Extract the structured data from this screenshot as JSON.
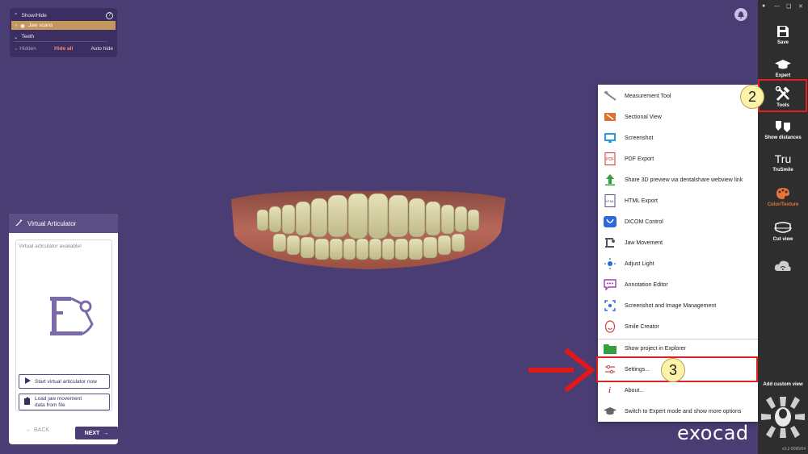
{
  "show_hide": {
    "title": "Show/Hide",
    "help": "?",
    "jaw_scans": "Jaw scans",
    "teeth": "Teeth",
    "hidden": "Hidden",
    "hide_all": "Hide all",
    "auto_hide": "Auto hide"
  },
  "articulator": {
    "title": "Virtual Articulator",
    "available": "Virtual articulator available!",
    "start_button": "Start virtual articulator now",
    "load_line1": "Load jaw movement",
    "load_line2": "data from file",
    "back": "BACK",
    "next": "NEXT"
  },
  "tools_menu": {
    "items": [
      {
        "label": "Measurement Tool",
        "icon": "caliper-icon"
      },
      {
        "label": "Sectional View",
        "icon": "sectional-view-icon"
      },
      {
        "label": "Screenshot",
        "icon": "monitor-icon"
      },
      {
        "label": "PDF Export",
        "icon": "pdf-icon"
      },
      {
        "label": "Share 3D preview via dentalshare webview link",
        "icon": "upload-arrow-icon"
      },
      {
        "label": "HTML Export",
        "icon": "html-icon"
      },
      {
        "label": "DICOM Control",
        "icon": "dicom-icon"
      },
      {
        "label": "Jaw Movement",
        "icon": "jaw-movement-icon"
      },
      {
        "label": "Adjust Light",
        "icon": "light-icon"
      },
      {
        "label": "Annotation Editor",
        "icon": "speech-bubble-icon"
      },
      {
        "label": "Screenshot and Image Management",
        "icon": "capture-icon"
      },
      {
        "label": "Smile Creator",
        "icon": "smile-icon"
      },
      {
        "label": "Show project in Explorer",
        "icon": "folder-icon"
      },
      {
        "label": "Settings...",
        "icon": "sliders-icon"
      },
      {
        "label": "About...",
        "icon": "info-icon"
      },
      {
        "label": "Switch to Expert mode and show more options",
        "icon": "graduation-cap-icon"
      }
    ]
  },
  "toolbar": {
    "save": "Save",
    "expert": "Expert",
    "tools": "Tools",
    "show_distances": "Show distances",
    "trusmile_logo": "Tru",
    "trusmile": "TruSmile",
    "color_texture": "Color/Texture",
    "cut_view": "Cut view",
    "add_custom_view": "Add custom view",
    "version": "v3.2-9095/64"
  },
  "callouts": {
    "two": "2",
    "three": "3"
  },
  "brand": "exocad",
  "colors": {
    "background": "#4a3d73",
    "accent_orange": "#e8743b",
    "highlight_red": "#e02020",
    "callout_yellow": "#fdf3a8"
  }
}
